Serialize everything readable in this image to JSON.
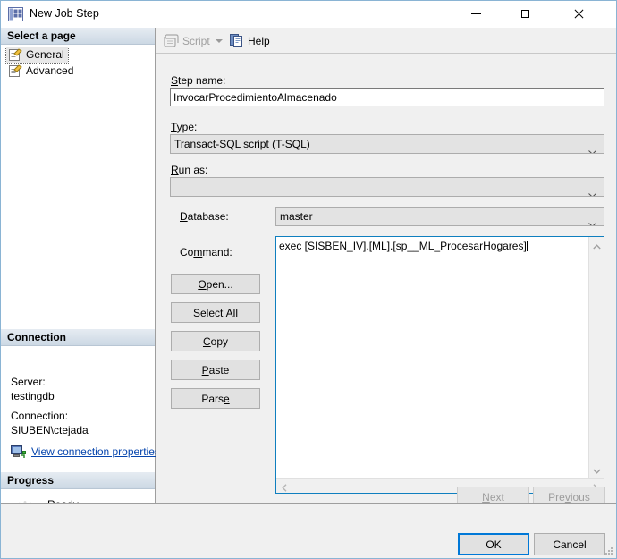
{
  "window": {
    "title": "New Job Step",
    "icon": "job-step-icon",
    "minimize_label": "Minimize",
    "maximize_label": "Maximize",
    "close_label": "Close"
  },
  "sidebar": {
    "select_page_header": "Select a page",
    "pages": [
      {
        "label": "General",
        "icon": "page-general-icon",
        "selected": true
      },
      {
        "label": "Advanced",
        "icon": "page-advanced-icon",
        "selected": false
      }
    ],
    "connection": {
      "header": "Connection",
      "server_label": "Server:",
      "server_value": "testingdb",
      "connection_label": "Connection:",
      "connection_value": "SIUBEN\\ctejada",
      "link_text": "View connection properties",
      "link_icon": "connection-properties-icon",
      "link_color": "#0645ad"
    },
    "progress": {
      "header": "Progress",
      "status": "Ready",
      "spinner_icon": "progress-spinner-icon"
    }
  },
  "toolbar": {
    "script_label": "Script",
    "script_icon": "script-icon",
    "script_enabled": false,
    "dropdown_icon": "chevron-down-icon",
    "help_label": "Help",
    "help_icon": "help-icon"
  },
  "form": {
    "step_name": {
      "label": "Step name:",
      "accelerator": "S",
      "value": "InvocarProcedimientoAlmacenado"
    },
    "type": {
      "label": "Type:",
      "accelerator": "T",
      "value": "Transact-SQL script (T-SQL)"
    },
    "run_as": {
      "label": "Run as:",
      "accelerator": "R",
      "value": ""
    },
    "database": {
      "label": "Database:",
      "accelerator": "D",
      "value": "master"
    },
    "command": {
      "label": "Command:",
      "accelerator": "m",
      "value": "exec [SISBEN_IV].[ML].[sp__ML_ProcesarHogares]"
    }
  },
  "command_buttons": [
    {
      "label": "Open...",
      "name": "open-button"
    },
    {
      "label": "Select All",
      "name": "select-all-button"
    },
    {
      "label": "Copy",
      "name": "copy-button"
    },
    {
      "label": "Paste",
      "name": "paste-button"
    },
    {
      "label": "Parse",
      "name": "parse-button"
    }
  ],
  "nav_buttons": {
    "next_label": "Next",
    "next_enabled": false,
    "previous_label": "Previous",
    "previous_enabled": false
  },
  "dialog_buttons": {
    "ok_label": "OK",
    "ok_default": true,
    "cancel_label": "Cancel",
    "accent_color": "#0078d7"
  }
}
